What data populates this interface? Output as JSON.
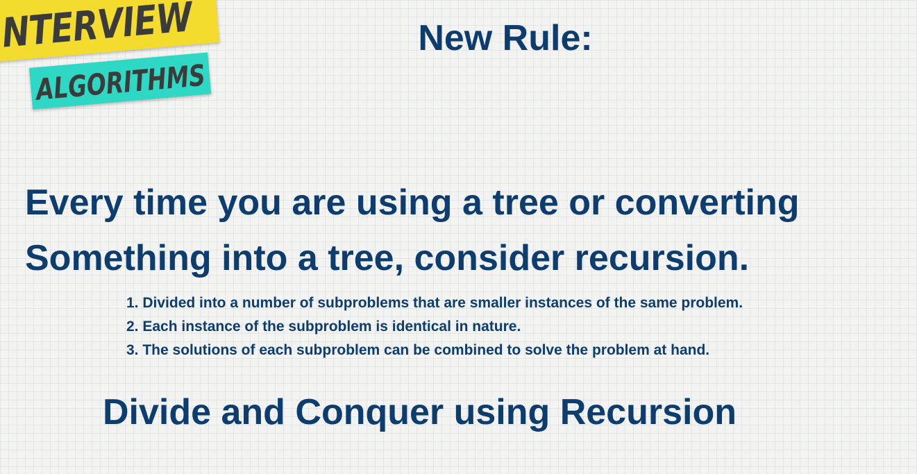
{
  "logo": {
    "top_text": "NTERVIEW",
    "bottom_text": "ALGORITHMS"
  },
  "slide": {
    "title": "New Rule:",
    "statement_line1": "Every time you are using a tree or converting",
    "statement_line2": "Something into a tree, consider recursion.",
    "points": [
      "1. Divided into a number of subproblems that are smaller instances of the same problem.",
      "2. Each instance of the subproblem is identical in nature.",
      "3. The solutions of each subproblem can be combined to solve the problem at hand."
    ],
    "footer": "Divide and Conquer using Recursion"
  },
  "colors": {
    "text": "#0d3c6e",
    "logo_yellow": "#f4dc2e",
    "logo_teal": "#2fd8c5",
    "logo_text": "#3b3b3b",
    "background": "#f3f3f1"
  }
}
